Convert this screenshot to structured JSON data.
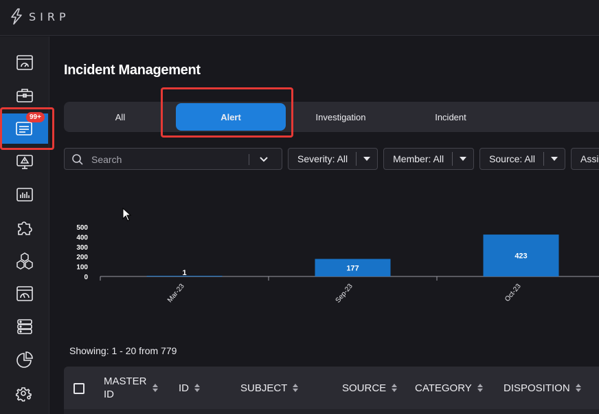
{
  "brand": {
    "logo_text": "SIRP"
  },
  "sidebar": {
    "items": [
      {
        "icon": "dashboard-icon",
        "active": false
      },
      {
        "icon": "briefcase-icon",
        "active": false
      },
      {
        "icon": "alerts-list-icon",
        "active": true,
        "badge": "99+"
      },
      {
        "icon": "monitor-warning-icon",
        "active": false
      },
      {
        "icon": "analytics-icon",
        "active": false
      },
      {
        "icon": "puzzle-icon",
        "active": false
      },
      {
        "icon": "cubes-icon",
        "active": false
      },
      {
        "icon": "gauge-icon",
        "active": false
      },
      {
        "icon": "database-icon",
        "active": false
      },
      {
        "icon": "pie-chart-icon",
        "active": false
      },
      {
        "icon": "settings-gear-icon",
        "active": false
      }
    ]
  },
  "page": {
    "title": "Incident Management"
  },
  "tabs": [
    {
      "label": "All",
      "active": false
    },
    {
      "label": "Alert",
      "active": true
    },
    {
      "label": "Investigation",
      "active": false
    },
    {
      "label": "Incident",
      "active": false
    }
  ],
  "filters": {
    "search_placeholder": "Search",
    "severity": "Severity: All",
    "member": "Member: All",
    "source": "Source: All",
    "assign": "Assig"
  },
  "chart_data": {
    "type": "bar",
    "categories": [
      "Mar-23",
      "Sep-23",
      "Oct-23"
    ],
    "values": [
      1,
      177,
      423
    ],
    "y_ticks": [
      0,
      100,
      200,
      300,
      400,
      500
    ],
    "ylim": [
      0,
      500
    ],
    "bar_color": "#1873c8"
  },
  "table": {
    "showing": "Showing: 1 - 20 from 779",
    "columns": [
      {
        "label_line1": "MASTER",
        "label_line2": "ID"
      },
      {
        "label_line1": "ID",
        "label_line2": ""
      },
      {
        "label_line1": "SUBJECT",
        "label_line2": ""
      },
      {
        "label_line1": "SOURCE",
        "label_line2": ""
      },
      {
        "label_line1": "CATEGORY",
        "label_line2": ""
      },
      {
        "label_line1": "DISPOSITION",
        "label_line2": ""
      }
    ]
  },
  "colors": {
    "accent": "#1e7fdc",
    "highlight": "#e53935"
  }
}
